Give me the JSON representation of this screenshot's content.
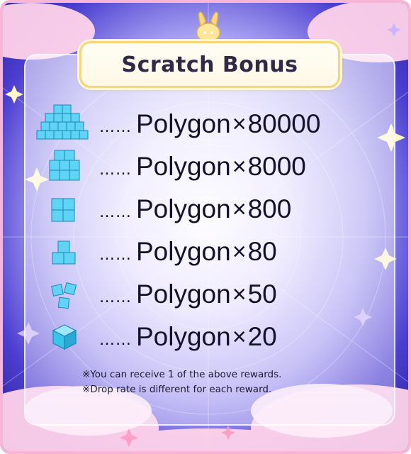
{
  "title": "Scratch Bonus",
  "rewards": [
    {
      "name": "Polygon",
      "mult": "×",
      "qty": "80000",
      "icon": "polygon-pile-icon"
    },
    {
      "name": "Polygon",
      "mult": "×",
      "qty": "8000",
      "icon": "polygon-stack-icon"
    },
    {
      "name": "Polygon",
      "mult": "×",
      "qty": "800",
      "icon": "polygon-cube-stack-icon"
    },
    {
      "name": "Polygon",
      "mult": "×",
      "qty": "80",
      "icon": "polygon-three-cubes-icon"
    },
    {
      "name": "Polygon",
      "mult": "×",
      "qty": "50",
      "icon": "polygon-small-cluster-icon"
    },
    {
      "name": "Polygon",
      "mult": "×",
      "qty": "20",
      "icon": "polygon-single-cube-icon"
    }
  ],
  "dots": "……",
  "notes": [
    "※You can receive 1 of the above rewards.",
    "※Drop rate is different for each reward."
  ],
  "colors": {
    "accent_pink": "#f7b6d6",
    "cube_blue": "#39c4ea",
    "title_border": "#f3d77a",
    "text": "#14122a"
  }
}
